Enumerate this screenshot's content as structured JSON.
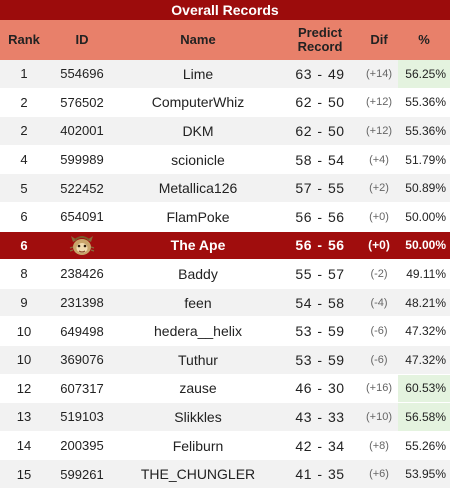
{
  "title": "Overall Records",
  "columns": {
    "rank": "Rank",
    "id": "ID",
    "name": "Name",
    "predict_line1": "Predict",
    "predict_line2": "Record",
    "dif": "Dif",
    "pct": "%"
  },
  "highlight_color": "#a00d0d",
  "rows": [
    {
      "rank": "1",
      "id": "554696",
      "name": "Lime",
      "w": "63",
      "sep": "-",
      "l": "49",
      "dif": "(+14)",
      "pct": "56.25%",
      "hi": true
    },
    {
      "rank": "2",
      "id": "576502",
      "name": "ComputerWhiz",
      "w": "62",
      "sep": "-",
      "l": "50",
      "dif": "(+12)",
      "pct": "55.36%",
      "hi": false
    },
    {
      "rank": "2",
      "id": "402001",
      "name": "DKM",
      "w": "62",
      "sep": "-",
      "l": "50",
      "dif": "(+12)",
      "pct": "55.36%",
      "hi": false
    },
    {
      "rank": "4",
      "id": "599989",
      "name": "scionicle",
      "w": "58",
      "sep": "-",
      "l": "54",
      "dif": "(+4)",
      "pct": "51.79%",
      "hi": false
    },
    {
      "rank": "5",
      "id": "522452",
      "name": "Metallica126",
      "w": "57",
      "sep": "-",
      "l": "55",
      "dif": "(+2)",
      "pct": "50.89%",
      "hi": false
    },
    {
      "rank": "6",
      "id": "654091",
      "name": "FlamPoke",
      "w": "56",
      "sep": "-",
      "l": "56",
      "dif": "(+0)",
      "pct": "50.00%",
      "hi": false
    },
    {
      "rank": "6",
      "id": "",
      "name": "The Ape",
      "w": "56",
      "sep": "-",
      "l": "56",
      "dif": "(+0)",
      "pct": "50.00%",
      "hi": false,
      "me": true,
      "avatar": "ape-avatar-icon"
    },
    {
      "rank": "8",
      "id": "238426",
      "name": "Baddy",
      "w": "55",
      "sep": "-",
      "l": "57",
      "dif": "(-2)",
      "pct": "49.11%",
      "hi": false
    },
    {
      "rank": "9",
      "id": "231398",
      "name": "feen",
      "w": "54",
      "sep": "-",
      "l": "58",
      "dif": "(-4)",
      "pct": "48.21%",
      "hi": false
    },
    {
      "rank": "10",
      "id": "649498",
      "name": "hedera__helix",
      "w": "53",
      "sep": "-",
      "l": "59",
      "dif": "(-6)",
      "pct": "47.32%",
      "hi": false
    },
    {
      "rank": "10",
      "id": "369076",
      "name": "Tuthur",
      "w": "53",
      "sep": "-",
      "l": "59",
      "dif": "(-6)",
      "pct": "47.32%",
      "hi": false
    },
    {
      "rank": "12",
      "id": "607317",
      "name": "zause",
      "w": "46",
      "sep": "-",
      "l": "30",
      "dif": "(+16)",
      "pct": "60.53%",
      "hi": true
    },
    {
      "rank": "13",
      "id": "519103",
      "name": "Slikkles",
      "w": "43",
      "sep": "-",
      "l": "33",
      "dif": "(+10)",
      "pct": "56.58%",
      "hi": true
    },
    {
      "rank": "14",
      "id": "200395",
      "name": "Feliburn",
      "w": "42",
      "sep": "-",
      "l": "34",
      "dif": "(+8)",
      "pct": "55.26%",
      "hi": false
    },
    {
      "rank": "15",
      "id": "599261",
      "name": "THE_CHUNGLER",
      "w": "41",
      "sep": "-",
      "l": "35",
      "dif": "(+6)",
      "pct": "53.95%",
      "hi": false
    }
  ]
}
